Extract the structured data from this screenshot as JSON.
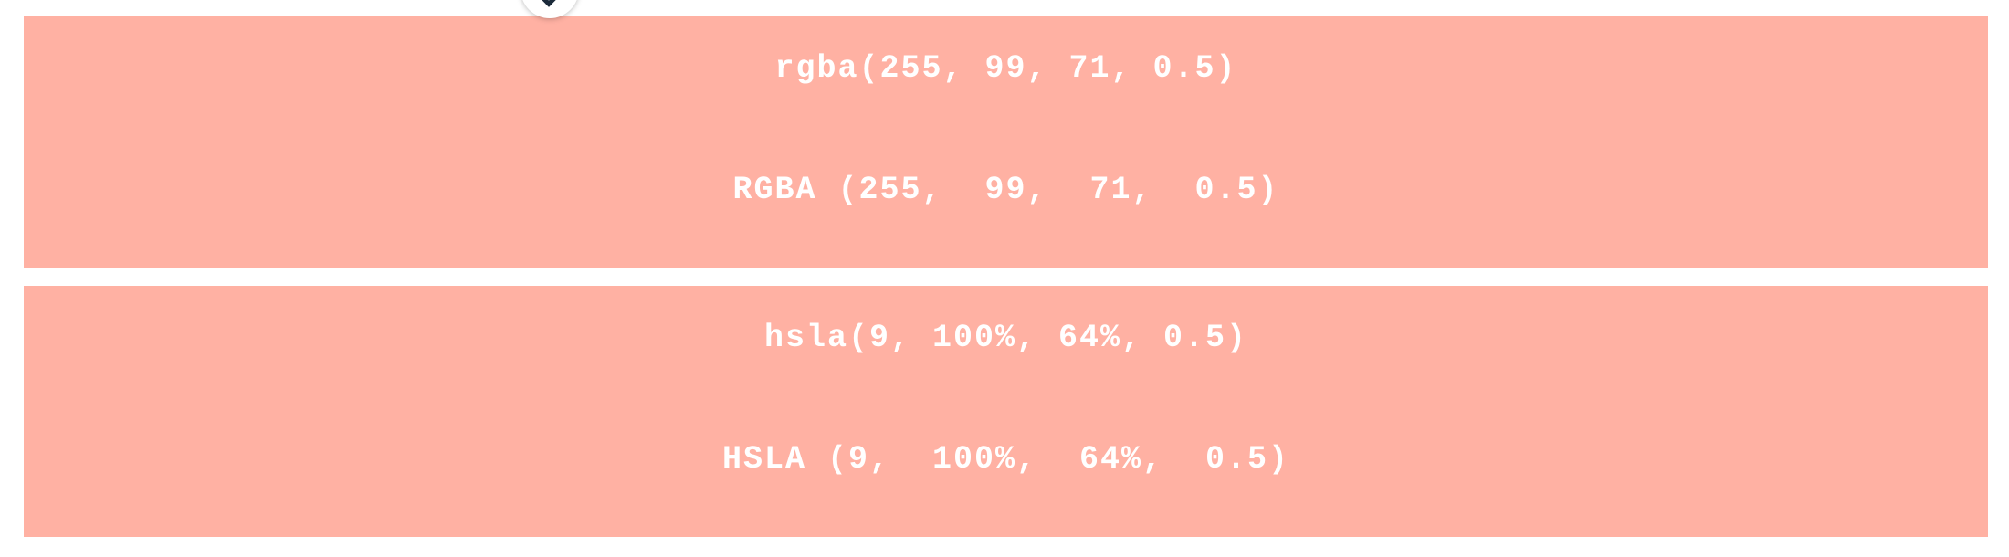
{
  "swatches": [
    {
      "color": "#ff6347",
      "line1": "rgba(255, 99, 71, 0.5)",
      "line2": "RGBA (255,  99,  71,  0.5)"
    },
    {
      "color": "#ff6347",
      "line1": "hsla(9, 100%, 64%, 0.5)",
      "line2": "HSLA (9,  100%,  64%,  0.5)"
    }
  ],
  "scroll_button": {
    "icon": "chevron-up-icon"
  }
}
